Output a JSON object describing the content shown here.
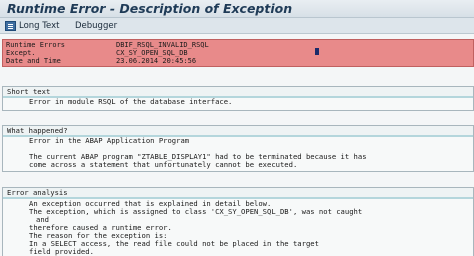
{
  "window": {
    "title": "Runtime Error - Description of Exception"
  },
  "toolbar": {
    "long_text": "Long Text",
    "debugger": "Debugger"
  },
  "header": {
    "runtime_errors_label": "Runtime Errors",
    "runtime_errors_value": "DBIF_RSQL_INVALID_RSQL",
    "except_label": "Except.",
    "except_value": "CX_SY_OPEN_SQL_DB",
    "date_label": "Date and Time",
    "date_value": "23.06.2014 20:45:56"
  },
  "short_text": {
    "heading": "Short text",
    "line1": "Error in module RSQL of the database interface."
  },
  "what_happened": {
    "heading": "What happened?",
    "line1": "Error in the ABAP Application Program",
    "line2": "The current ABAP program \"ZTABLE_DISPLAY1\" had to be terminated because it has",
    "line3": "come across a statement that unfortunately cannot be executed."
  },
  "error_analysis": {
    "heading": "Error analysis",
    "line1": "An exception occurred that is explained in detail below.",
    "line2": "The exception, which is assigned to class 'CX_SY_OPEN_SQL_DB', was not caught",
    "line3": "and",
    "line4": "therefore caused a runtime error.",
    "line5": "The reason for the exception is:",
    "line6": "In a SELECT access, the read file could not be placed in the target",
    "line7": "field provided."
  },
  "colors": {
    "header_bg": "#e88a8a",
    "section_rule": "#b4d6dc",
    "title": "#1f3b57"
  }
}
